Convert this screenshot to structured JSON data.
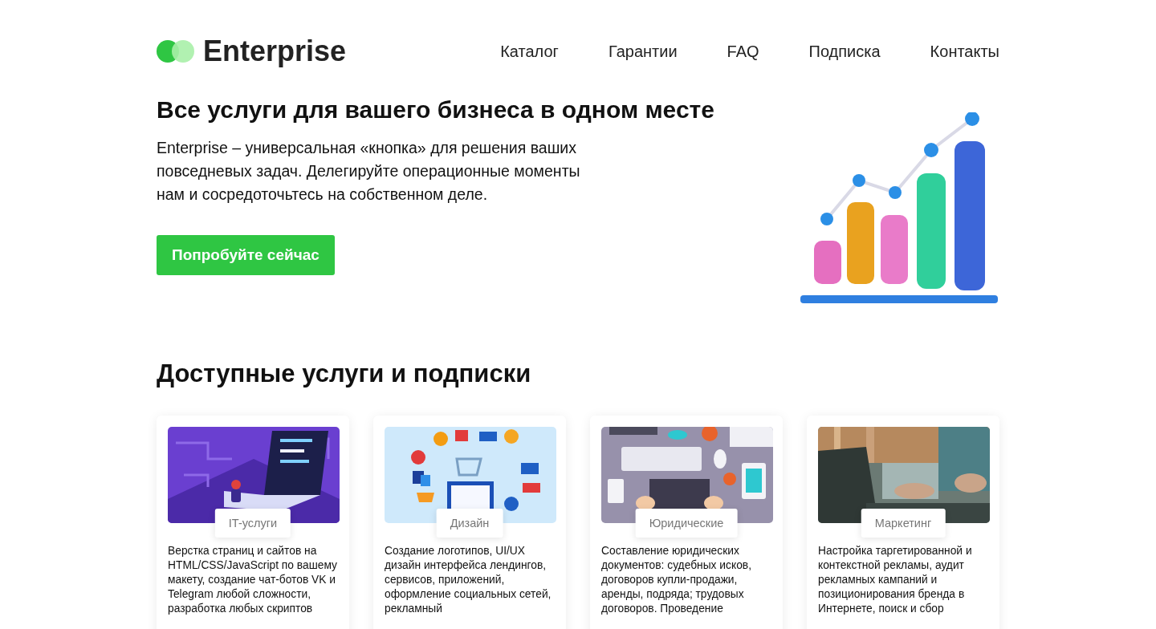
{
  "header": {
    "logo": "Enterprise",
    "nav": [
      {
        "label": "Каталог"
      },
      {
        "label": "Гарантии"
      },
      {
        "label": "FAQ"
      },
      {
        "label": "Подписка"
      },
      {
        "label": "Контакты"
      }
    ]
  },
  "hero": {
    "title": "Все услуги для вашего бизнеса в одном месте",
    "text": "Enterprise – универсальная «кнопка» для решения ваших повседневых задач. Делегируйте операционные моменты нам и сосредоточьтесь на собственном деле.",
    "button": "Попробуйте сейчас"
  },
  "services": {
    "title": "Доступные услуги и подписки",
    "cards": [
      {
        "tag": "IT-услуги",
        "text": "Верстка страниц и сайтов на HTML/CSS/JavaScript по вашему макету, создание чат-ботов VK и Telegram любой сложности, разработка любых скриптов"
      },
      {
        "tag": "Дизайн",
        "text": "Создание логотипов, UI/UX дизайн интерфейса лендингов, сервисов, приложений, оформление социальных сетей, рекламный"
      },
      {
        "tag": "Юридические",
        "text": "Составление юридических документов: судебных исков, договоров купли-продажи, аренды, подряда; трудовых договоров. Проведение"
      },
      {
        "tag": "Маркетинг",
        "text": "Настройка таргетированной и контекстной рекламы, аудит рекламных кампаний и позиционирования бренда в Интернете, поиск и сбор"
      }
    ]
  }
}
